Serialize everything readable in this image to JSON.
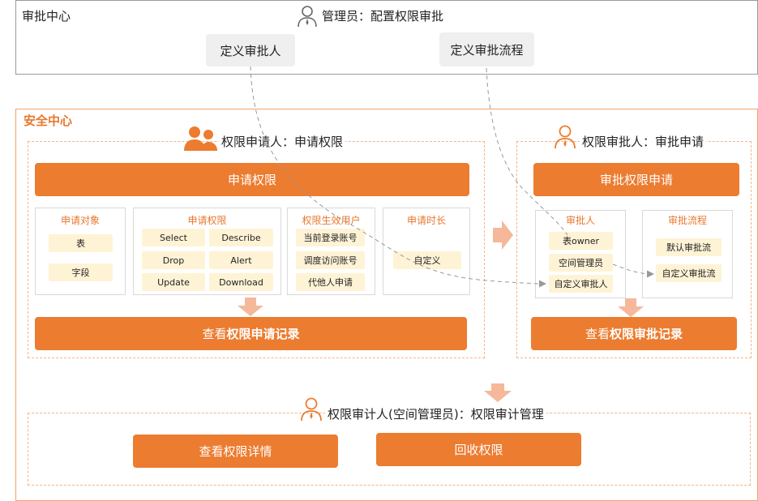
{
  "approval_center": {
    "title": "审批中心",
    "admin_label": "管理员：配置权限审批",
    "define_approver": "定义审批人",
    "define_flow": "定义审批流程"
  },
  "security_center": {
    "title": "安全中心",
    "applicant": {
      "header": "权限申请人：申请权限",
      "apply_button": "申请权限",
      "panels": {
        "object": {
          "title": "申请对象",
          "items": [
            "表",
            "字段"
          ]
        },
        "permission": {
          "title": "申请权限",
          "items": [
            "Select",
            "Describe",
            "Drop",
            "Alert",
            "Update",
            "Download"
          ]
        },
        "user": {
          "title": "权限生效用户",
          "items": [
            "当前登录账号",
            "调度访问账号",
            "代他人申请"
          ]
        },
        "duration": {
          "title": "申请时长",
          "items": [
            "自定义"
          ]
        }
      },
      "records_prefix": "查看",
      "records_bold": "权限申请记录"
    },
    "approver": {
      "header": "权限审批人：审批申请",
      "approve_button": "审批权限申请",
      "panels": {
        "approver": {
          "title": "审批人",
          "items": [
            "表owner",
            "空间管理员",
            "自定义审批人"
          ]
        },
        "flow": {
          "title": "审批流程",
          "items": [
            "默认审批流",
            "自定义审批流"
          ]
        }
      },
      "records_prefix": "查看",
      "records_bold": "权限审批记录"
    },
    "auditor": {
      "header": "权限审计人(空间管理员)：权限审计管理",
      "view_details": "查看权限详情",
      "revoke": "回收权限"
    }
  },
  "colors": {
    "accent": "#ec7c30",
    "chip_fill": "#fff3d6",
    "arrow_fill": "#f5b89a",
    "dashed_border": "#f3b58a"
  }
}
